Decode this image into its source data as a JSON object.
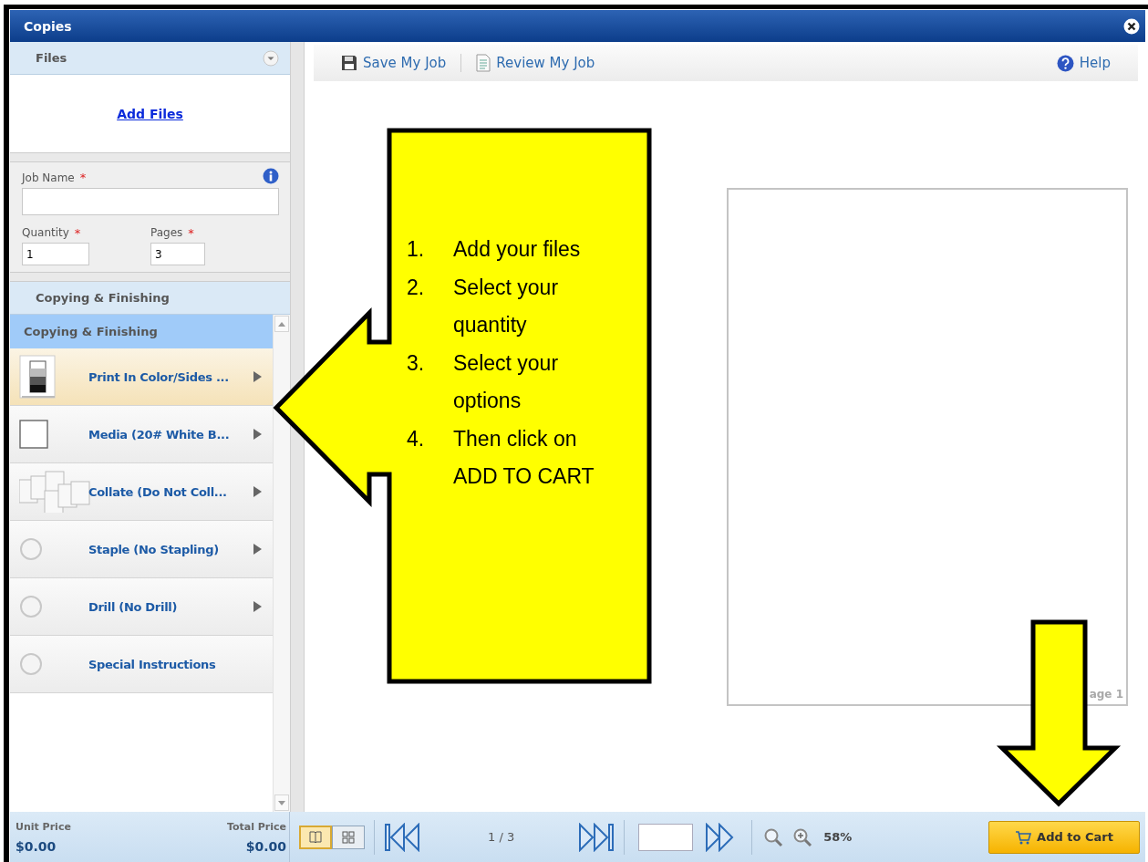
{
  "window": {
    "title": "Copies"
  },
  "files_panel": {
    "title": "Files",
    "link": "Add Files"
  },
  "job_form": {
    "job_name": {
      "label": "Job Name",
      "required_mark": "*"
    },
    "quantity": {
      "label": "Quantity",
      "required_mark": "*",
      "value": "1"
    },
    "pages": {
      "label": "Pages",
      "required_mark": "*",
      "value": "3"
    }
  },
  "finishing_panel": {
    "title": "Copying & Finishing",
    "list_header": "Copying & Finishing",
    "options": [
      {
        "kind": "tones",
        "label": "Print In Color/Sides ...",
        "selected": true,
        "has_submenu": true
      },
      {
        "kind": "blank",
        "label": "Media (20# White B...",
        "selected": false,
        "has_submenu": true
      },
      {
        "kind": "collate",
        "label": "Collate (Do Not Coll...",
        "selected": false,
        "has_submenu": true
      },
      {
        "kind": "circle",
        "label": "Staple (No Stapling)",
        "selected": false,
        "has_submenu": true
      },
      {
        "kind": "circle",
        "label": "Drill (No Drill)",
        "selected": false,
        "has_submenu": true
      },
      {
        "kind": "circle",
        "label": "Special Instructions",
        "selected": false,
        "has_submenu": false
      }
    ]
  },
  "toolbar": {
    "items": [
      {
        "kind": "save",
        "label": "Save My Job"
      },
      {
        "kind": "review",
        "label": "Review My Job"
      }
    ],
    "help": "Help"
  },
  "preview": {
    "page_label": "age 1"
  },
  "footer": {
    "unit_price": {
      "label": "Unit Price",
      "value": "$0.00"
    },
    "total_price": {
      "label": "Total Price",
      "value": "$0.00"
    },
    "views": [
      {
        "kind": "single",
        "selected": true
      },
      {
        "kind": "grid",
        "selected": false
      }
    ],
    "page_indicator": "1 / 3",
    "zoom": "58%",
    "add_to_cart": "Add to Cart"
  },
  "annotation": {
    "steps": [
      {
        "number": "1.",
        "text": "Add your files"
      },
      {
        "number": "2.",
        "text": "Select your quantity"
      },
      {
        "number": "3.",
        "text": "Select your options"
      },
      {
        "number": "4.",
        "text": "Then click on ADD TO CART"
      }
    ]
  }
}
